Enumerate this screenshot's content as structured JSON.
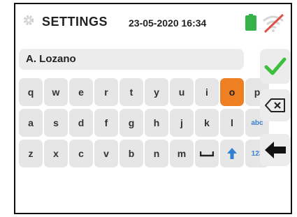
{
  "header": {
    "title": "SETTINGS",
    "datetime": "23-05-2020 16:34",
    "gear_icon": "gear-icon",
    "battery_icon": "battery-full-icon",
    "wifi_icon": "wifi-off-icon"
  },
  "input": {
    "value": "A. Lozano"
  },
  "keyboard": {
    "row1": [
      "q",
      "w",
      "e",
      "r",
      "t",
      "y",
      "u",
      "i",
      "o",
      "p"
    ],
    "row2": [
      "a",
      "s",
      "d",
      "f",
      "g",
      "h",
      "j",
      "k",
      "l",
      "abc"
    ],
    "row3": [
      "z",
      "x",
      "c",
      "v",
      "b",
      "n",
      "m",
      "space",
      "shift",
      "123"
    ],
    "active_key": "o"
  },
  "side_buttons": {
    "confirm_icon": "checkmark-icon",
    "backspace_icon": "backspace-icon",
    "back_icon": "back-arrow-icon"
  },
  "colors": {
    "accent_orange": "#ee7f22",
    "check_green": "#3cbf3c",
    "battery_green": "#36b24a",
    "wifi_off_red": "#e0504a",
    "link_blue": "#3b7fd0"
  }
}
